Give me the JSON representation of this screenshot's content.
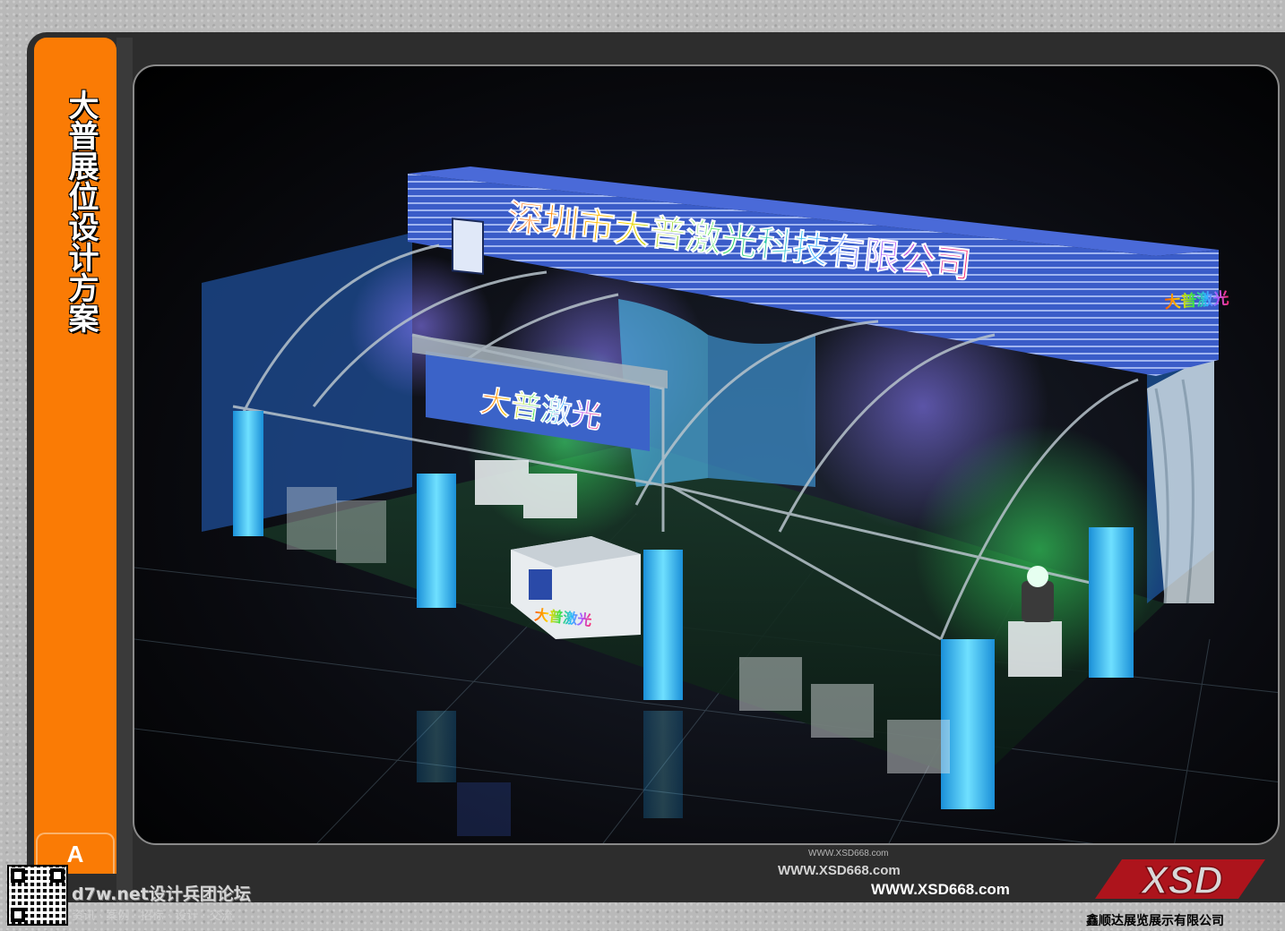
{
  "sidebar": {
    "title": "大普展位设计方案",
    "tab_label": "A"
  },
  "booth": {
    "header_sign": "深圳市大普激光科技有限公司",
    "side_sign": "大普激光",
    "front_sign": "大普激光",
    "counter_sign": "大普激光"
  },
  "watermarks": {
    "small": "WWW.XSD668.com",
    "mid": "WWW.XSD668.com",
    "main": "WWW.XSD668.com",
    "forum": "d7w.net设计兵团论坛",
    "forum_sub": "资讯 · 案例 · 招标 · 设计 · 交流"
  },
  "footer": {
    "logo": "XSD",
    "company": "鑫顺达展览展示有限公司"
  },
  "colors": {
    "sidebar": "#fa7b05",
    "frame": "#2d2d2d",
    "sign_blue": "#2f4fc0",
    "light_blue": "#2fb8ff"
  }
}
